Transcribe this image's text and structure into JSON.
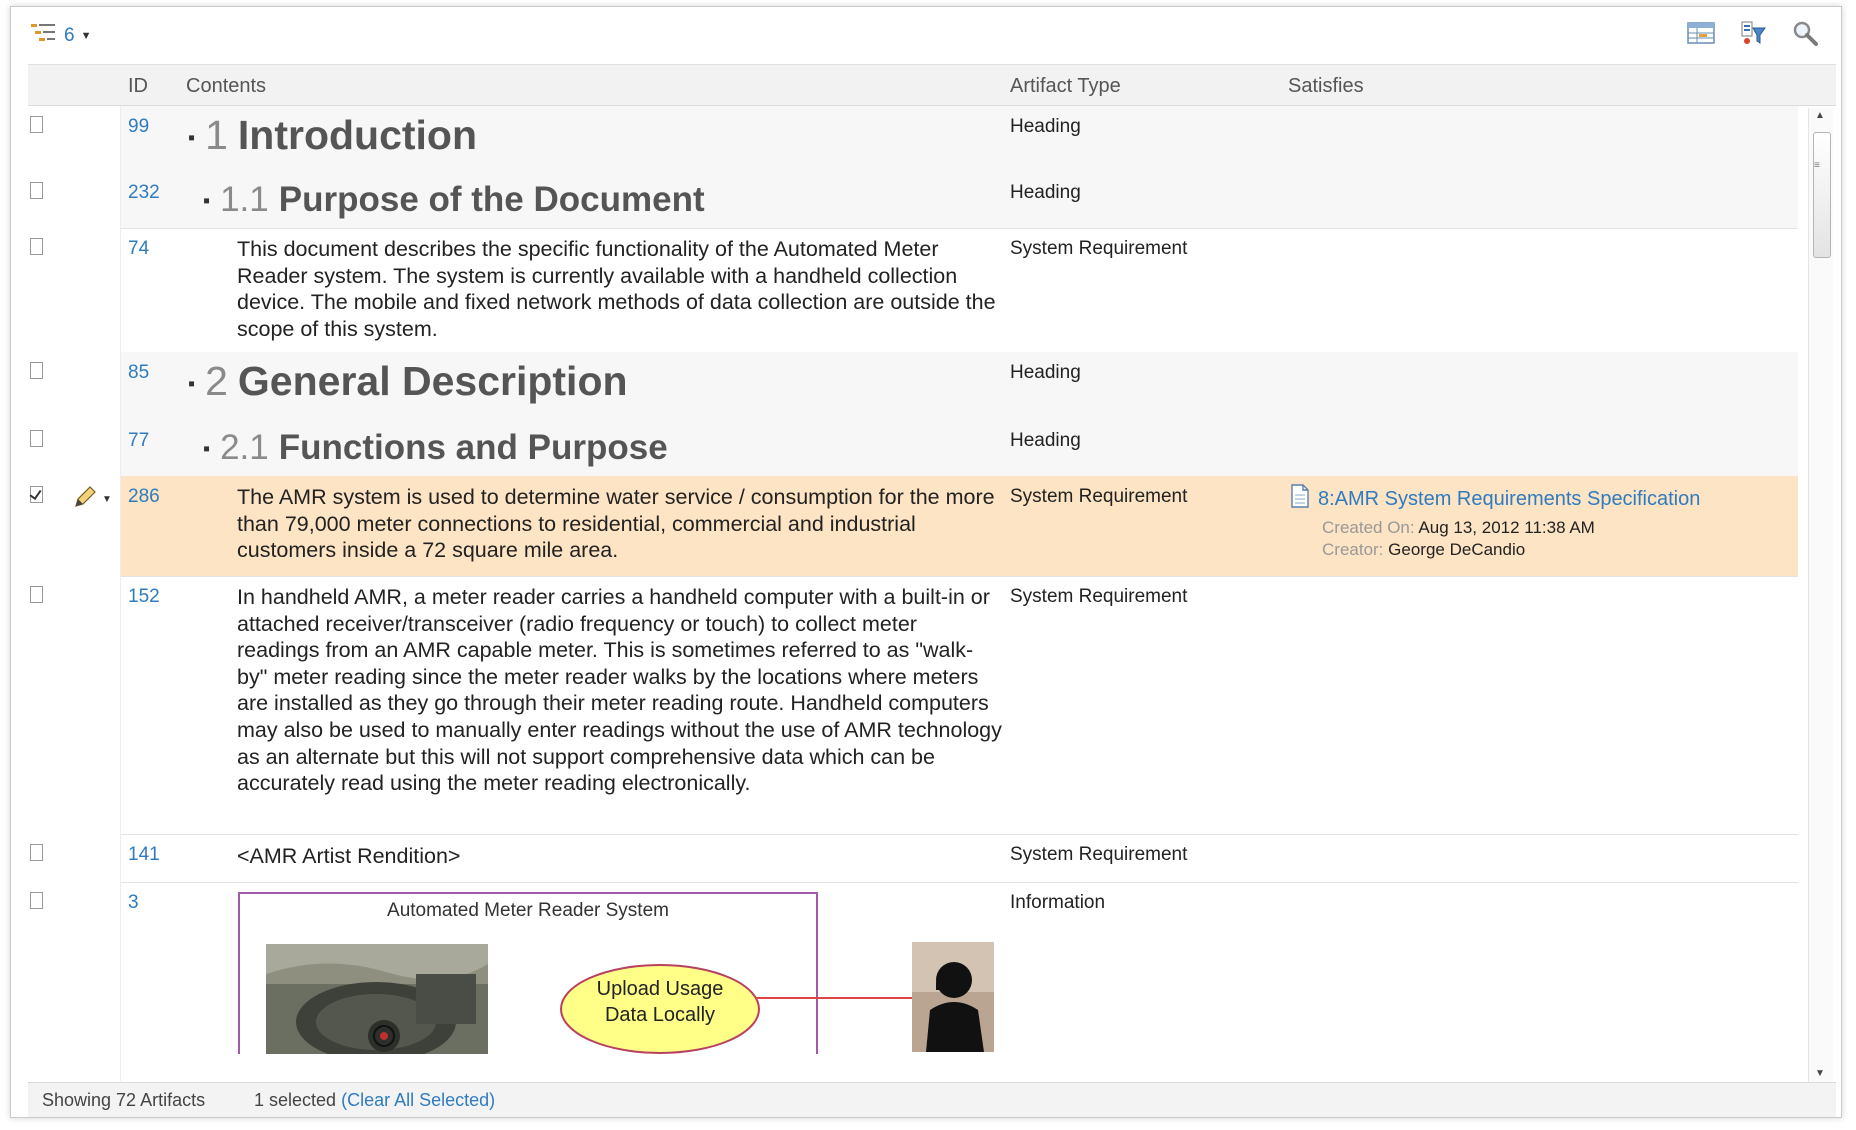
{
  "toolbar": {
    "level_count": "6",
    "icons": [
      "tree-levels-icon",
      "grid-layout-icon",
      "filter-icon",
      "search-icon"
    ]
  },
  "columns": {
    "id": "ID",
    "contents": "Contents",
    "artifact_type": "Artifact Type",
    "satisfies": "Satisfies"
  },
  "rows": [
    {
      "id": "99",
      "number": "1",
      "title": "Introduction",
      "type": "Heading"
    },
    {
      "id": "232",
      "number": "1.1",
      "title": "Purpose of the Document",
      "type": "Heading"
    },
    {
      "id": "74",
      "type": "System Requirement",
      "text": "This document describes the specific functionality of the Automated Meter Reader system. The system is currently available with a handheld collection device. The mobile and fixed network methods of data collection are outside the scope of this system."
    },
    {
      "id": "85",
      "number": "2",
      "title": "General Description",
      "type": "Heading"
    },
    {
      "id": "77",
      "number": "2.1",
      "title": "Functions and Purpose",
      "type": "Heading"
    },
    {
      "id": "286",
      "type": "System Requirement",
      "text": "The AMR system is used to determine water service / consumption for the more than 79,000 meter connections to residential, commercial and industrial customers inside a 72 square mile area.",
      "satisfies": {
        "link": "8:AMR System Requirements Specification",
        "created_label": "Created On:",
        "created_value": "Aug 13, 2012 11:38 AM",
        "creator_label": "Creator:",
        "creator_value": "George DeCandio"
      }
    },
    {
      "id": "152",
      "type": "System Requirement",
      "text": "In handheld AMR, a meter reader carries a handheld computer with a built-in or attached receiver/transceiver (radio frequency or touch) to collect meter readings from an AMR capable meter. This is sometimes referred to as \"walk-by\" meter reading since the meter reader walks by the locations where meters are installed as they go through their meter reading route. Handheld computers may also be used to manually enter readings without the use of AMR technology as an alternate but this will not support comprehensive data which can be accurately read using the meter reading electronically."
    },
    {
      "id": "141",
      "type": "System Requirement",
      "text": "<AMR Artist Rendition>"
    },
    {
      "id": "3",
      "type": "Information",
      "figure_title": "Automated Meter Reader System",
      "ellipse_line1": "Upload Usage",
      "ellipse_line2": "Data Locally"
    }
  ],
  "status": {
    "showing": "Showing 72 Artifacts",
    "selected": "1 selected",
    "clear_open": "(",
    "clear_link": "Clear All Selected",
    "clear_close": ")"
  },
  "colors": {
    "link": "#2f7bc0",
    "selected_row": "#fde4c4",
    "figure_border": "#a05aa8",
    "ellipse_fill": "#ffff88",
    "connector": "#d44444"
  }
}
